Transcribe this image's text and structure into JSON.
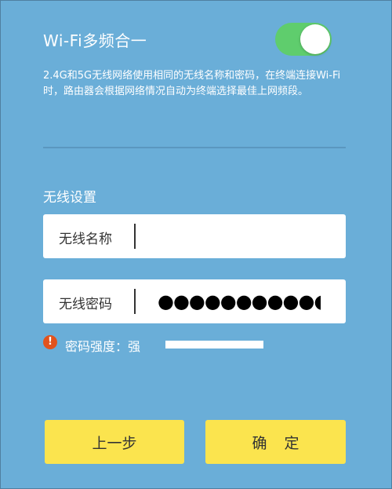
{
  "wifi_merge": {
    "title": "Wi-Fi多频合一",
    "enabled": true,
    "description": "2.4G和5G无线网络使用相同的无线名称和密码，在终端连接Wi-Fi时，路由器会根据网络情况自动为终端选择最佳上网频段。"
  },
  "wireless": {
    "section_title": "无线设置",
    "ssid_label": "无线名称",
    "ssid_value": "",
    "password_label": "无线密码",
    "password_display": "●●●●●●●●●●●●"
  },
  "strength": {
    "icon": "exclamation-icon",
    "icon_glyph": "!",
    "label": "密码强度：强",
    "level": 1.0
  },
  "buttons": {
    "prev_label": "上一步",
    "confirm_label": "确 定"
  },
  "colors": {
    "background": "#6aaed8",
    "toggle_on": "#5fcd6d",
    "button": "#fbe44e",
    "warning": "#e2531d"
  }
}
